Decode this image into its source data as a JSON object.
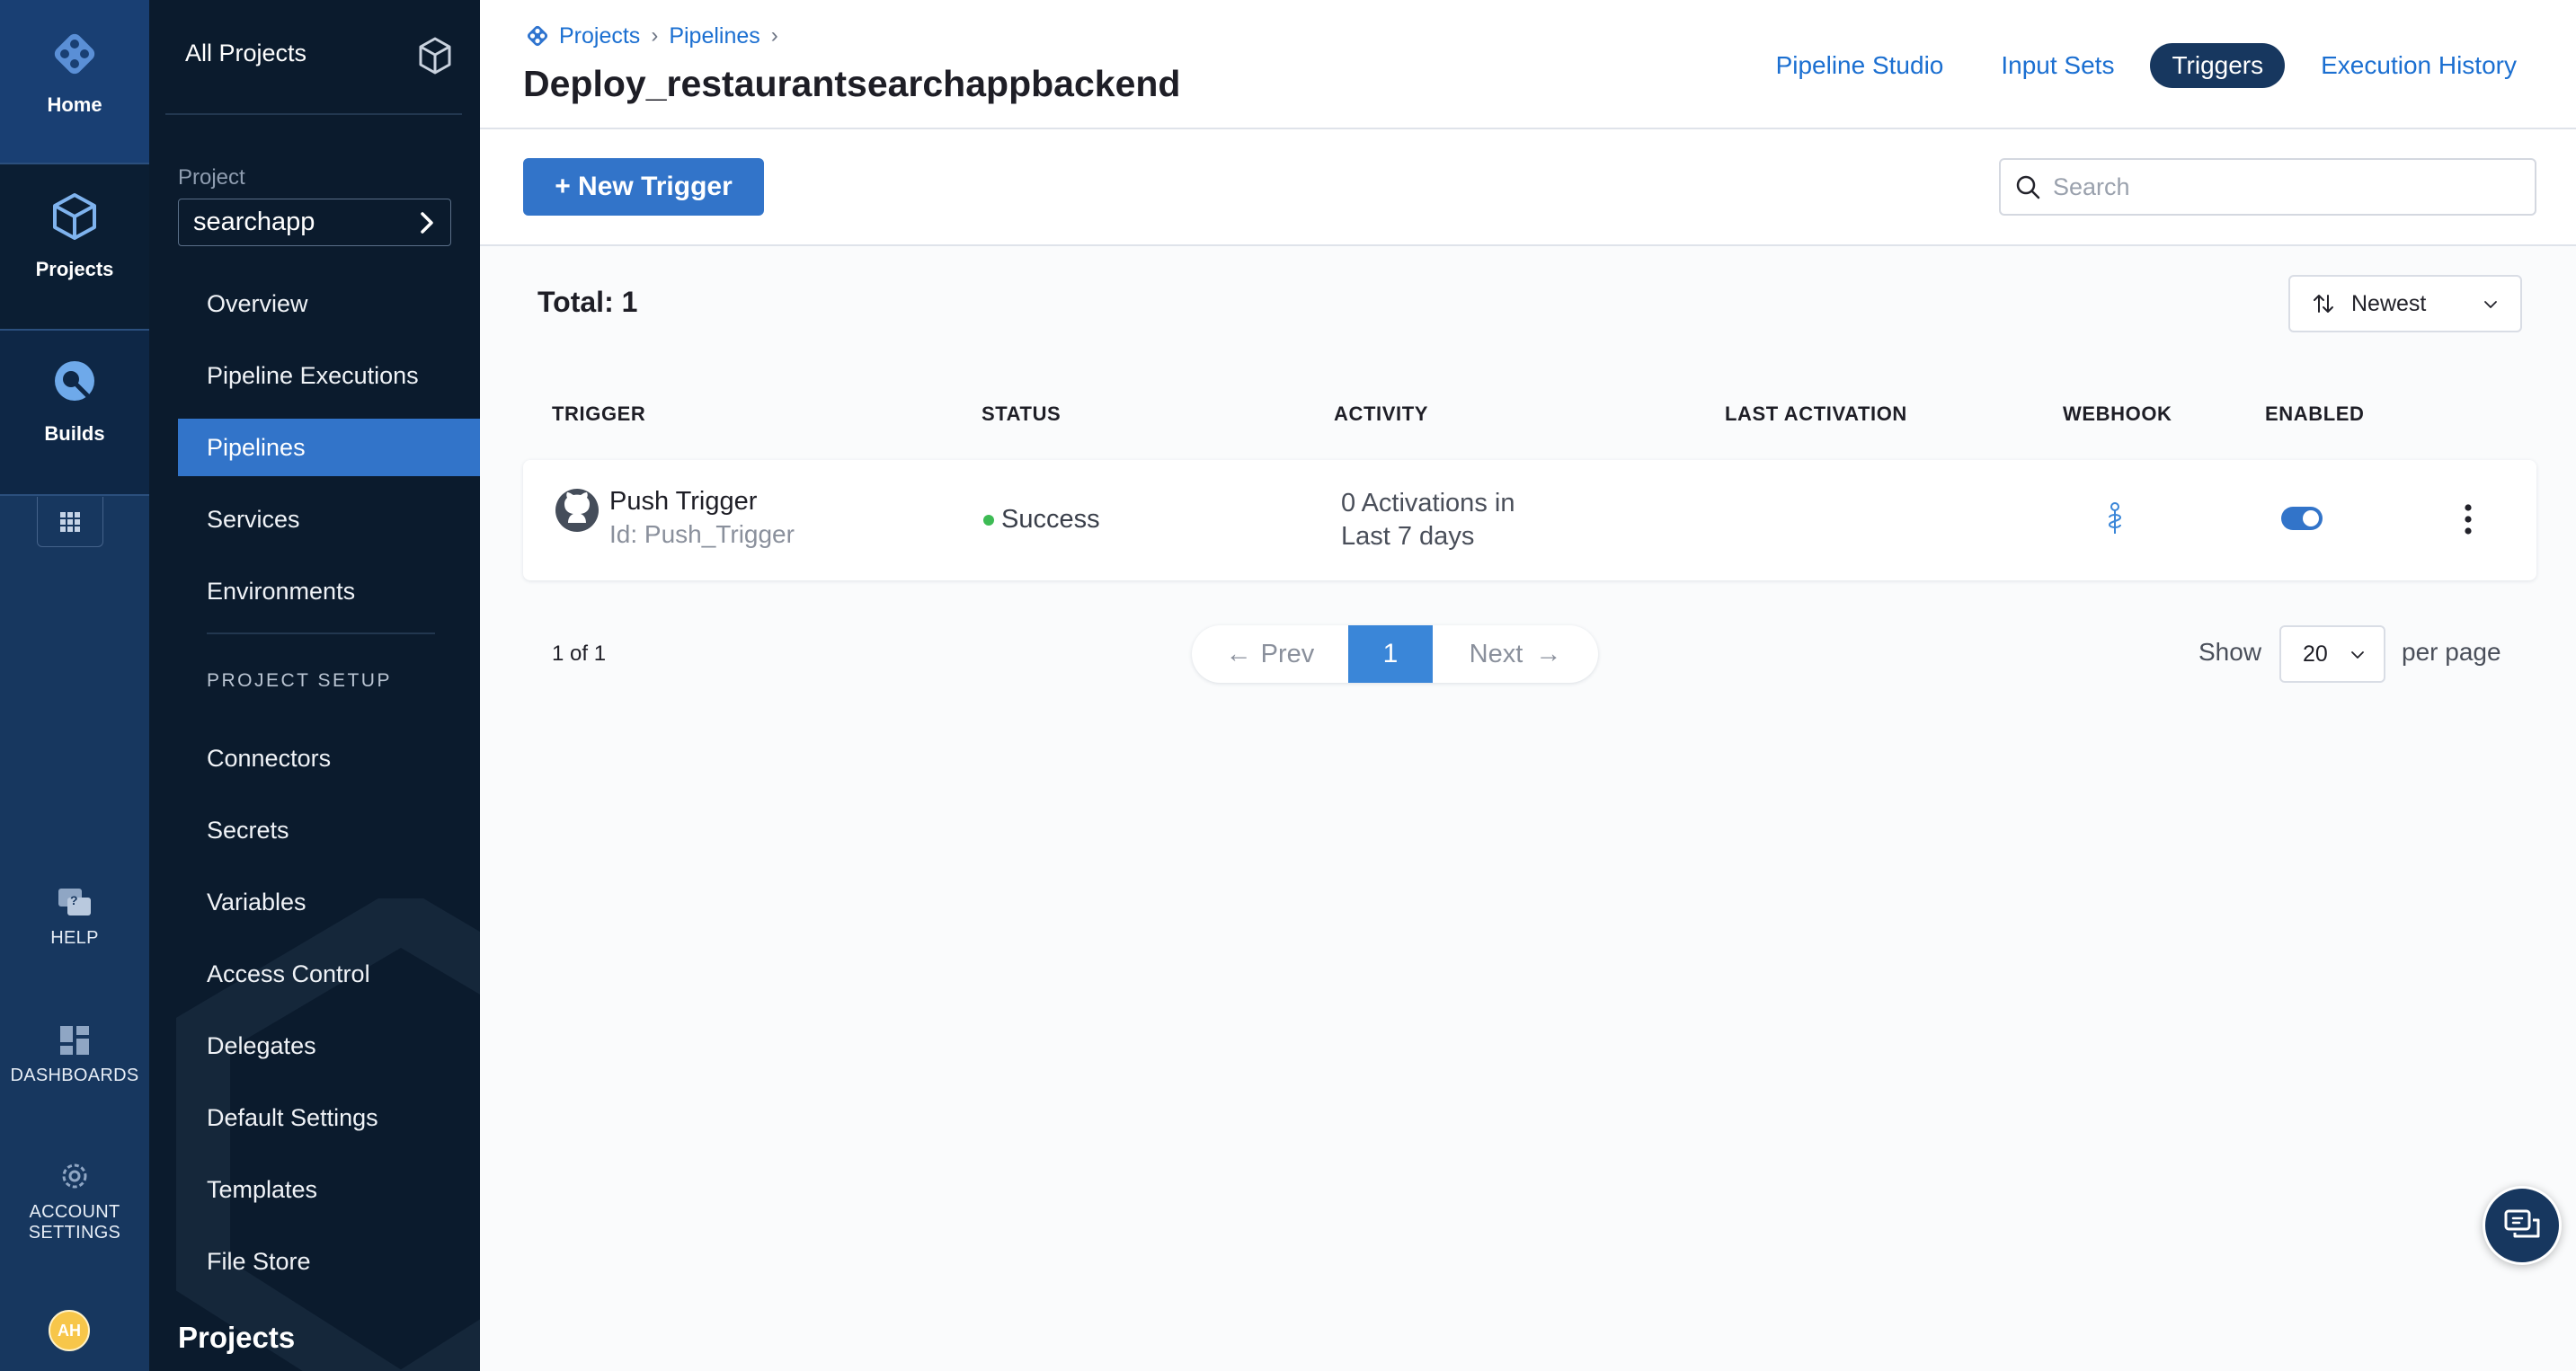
{
  "rail": {
    "home": "Home",
    "projects": "Projects",
    "builds": "Builds",
    "help": "HELP",
    "dashboards": "DASHBOARDS",
    "account_settings_1": "ACCOUNT",
    "account_settings_2": "SETTINGS",
    "avatar": "AH"
  },
  "sidebar": {
    "all_projects": "All Projects",
    "project_caption": "Project",
    "project_value": "searchapp",
    "items": [
      {
        "label": "Overview"
      },
      {
        "label": "Pipeline Executions"
      },
      {
        "label": "Pipelines"
      },
      {
        "label": "Services"
      },
      {
        "label": "Environments"
      }
    ],
    "setup_heading": "PROJECT SETUP",
    "setup_items": [
      {
        "label": "Connectors"
      },
      {
        "label": "Secrets"
      },
      {
        "label": "Variables"
      },
      {
        "label": "Access Control"
      },
      {
        "label": "Delegates"
      },
      {
        "label": "Default Settings"
      },
      {
        "label": "Templates"
      },
      {
        "label": "File Store"
      }
    ],
    "footer": "Projects"
  },
  "header": {
    "breadcrumbs": [
      "Projects",
      "Pipelines"
    ],
    "title": "Deploy_restaurantsearchappbackend",
    "tabs": [
      {
        "label": "Pipeline Studio"
      },
      {
        "label": "Input Sets"
      },
      {
        "label": "Triggers"
      },
      {
        "label": "Execution History"
      }
    ],
    "active_tab": "Triggers"
  },
  "toolbar": {
    "new_trigger_label": "+ New Trigger",
    "search_placeholder": "Search"
  },
  "list": {
    "total_label": "Total: 1",
    "sort_label": "Newest",
    "columns": [
      "TRIGGER",
      "STATUS",
      "ACTIVITY",
      "LAST ACTIVATION",
      "WEBHOOK",
      "ENABLED"
    ],
    "rows": [
      {
        "name": "Push Trigger",
        "id": "Id: Push_Trigger",
        "status": "Success",
        "activity_line1": "0 Activations in",
        "activity_line2": "Last 7 days",
        "last_activation": "",
        "enabled": true
      }
    ]
  },
  "pagination": {
    "count": "1 of 1",
    "prev": "Prev",
    "current": "1",
    "next": "Next",
    "show_label": "Show",
    "per_page_value": "20",
    "per_page_label": "per page"
  },
  "colors": {
    "accent": "#3274c9",
    "rail": "#17375f",
    "sidebar": "#0b1b2d",
    "success": "#3dbb54"
  }
}
